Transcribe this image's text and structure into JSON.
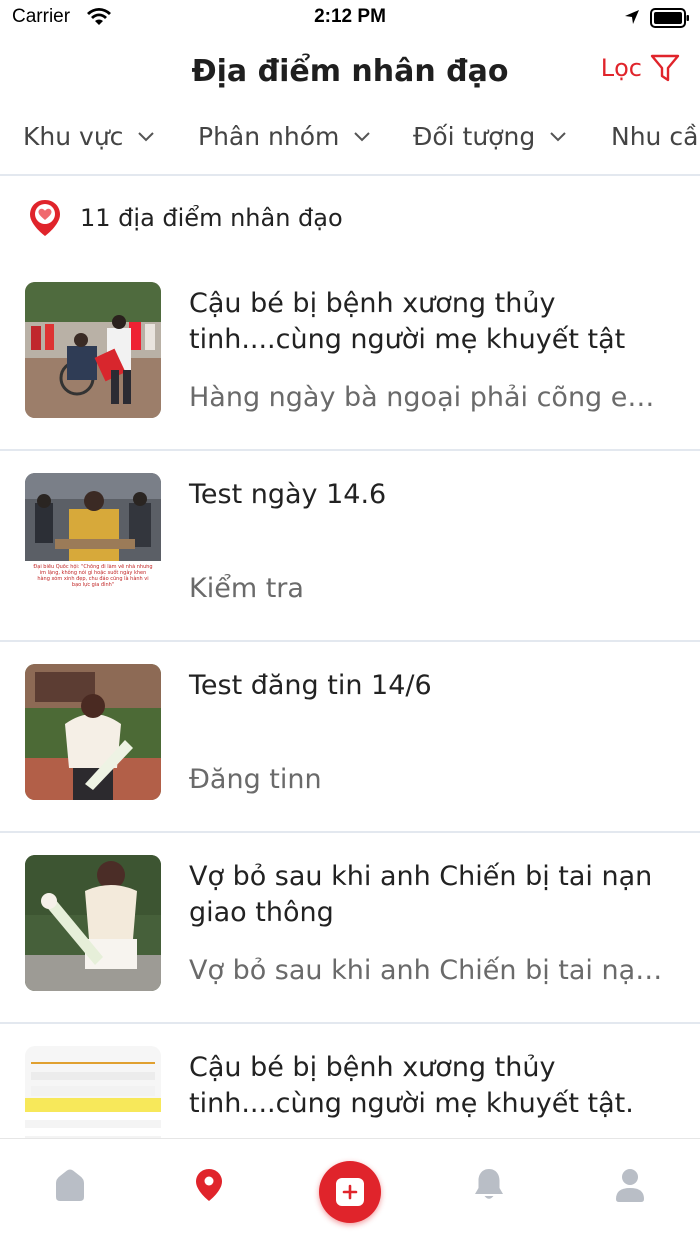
{
  "status_bar": {
    "carrier": "Carrier",
    "time": "2:12 PM"
  },
  "header": {
    "title": "Địa điểm nhân đạo",
    "filter_label": "Lọc"
  },
  "tabs": [
    {
      "label": "Khu vực"
    },
    {
      "label": "Phân nhóm"
    },
    {
      "label": "Đối tượng"
    },
    {
      "label": "Nhu cầu"
    }
  ],
  "count_text": "11 địa điểm nhân đạo",
  "items": [
    {
      "title": "Cậu bé bị bệnh xương thủy tinh....cùng người mẹ khuyết tật",
      "desc": "Hàng ngày bà ngoại phải cõng em đi học"
    },
    {
      "title": "Test ngày 14.6",
      "desc": "Kiểm tra",
      "thumb_caption": "Đại biểu Quốc hội: \"Chồng đi làm về nhà nhưng im lặng, không nói gì hoặc suốt ngày khen hàng xóm xinh đẹp, chu đáo cũng là hành vi bạo lực gia đình\""
    },
    {
      "title": "Test đăng tin 14/6",
      "desc": "Đăng tinn"
    },
    {
      "title": "Vợ bỏ sau khi anh Chiến bị tai nạn giao thông",
      "desc": "Vợ bỏ sau khi anh Chiến bị tai nạn giao thông"
    },
    {
      "title": "Cậu bé bị bệnh xương thủy tinh....cùng người mẹ khuyết tật.",
      "desc": ""
    }
  ],
  "tabbar": {
    "items": [
      "home-icon",
      "map-pin-icon",
      "add-post-icon",
      "bell-icon",
      "user-icon"
    ],
    "active": "map-pin-icon"
  },
  "colors": {
    "accent": "#e0242b",
    "inactive_icon": "#b9bec6",
    "divider": "#e3e8ef"
  }
}
